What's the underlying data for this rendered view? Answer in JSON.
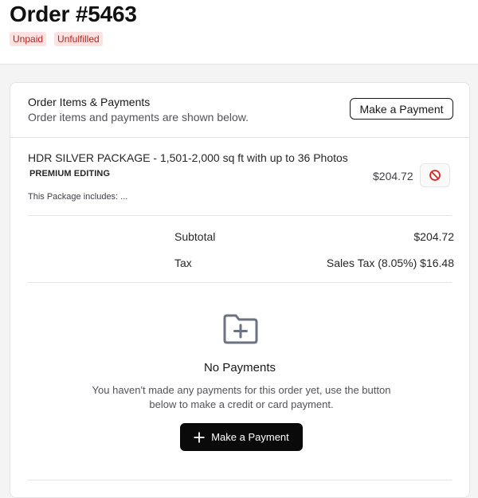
{
  "page": {
    "title": "Order #5463",
    "badges": [
      "Unpaid",
      "Unfulfilled"
    ]
  },
  "card": {
    "title": "Order Items & Payments",
    "subtitle": "Order items and payments are shown below.",
    "make_payment_button": "Make a Payment"
  },
  "item": {
    "name": "HDR SILVER PACKAGE  - 1,501-2,000 sq ft with up to 36 Photos",
    "editing": "PREMIUM EDITING",
    "price": "$204.72",
    "includes": "This Package includes: ...",
    "remove_icon": "prohibit-icon"
  },
  "summary": {
    "subtotal_label": "Subtotal",
    "subtotal_value": "$204.72",
    "tax_label": "Tax",
    "tax_detail": "Sales Tax (8.05%)",
    "tax_value": "$16.48"
  },
  "empty": {
    "icon": "folder-plus-icon",
    "title": "No Payments",
    "description": "You haven't made any payments for this order yet, use the button below to make a credit or card payment.",
    "button": "Make a Payment"
  },
  "colors": {
    "badge_bg": "#fde2e2",
    "badge_text": "#b3261e",
    "remove_icon": "#dc2626",
    "primary_button": "#0a0a0a"
  }
}
